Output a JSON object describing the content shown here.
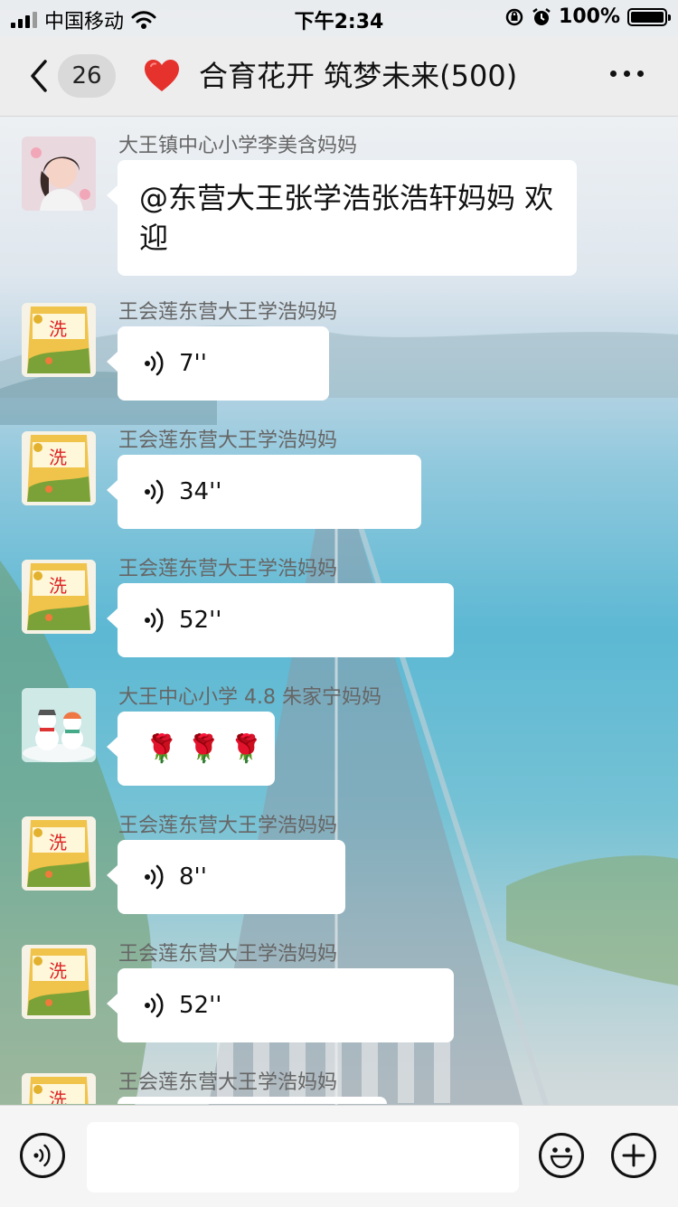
{
  "status_bar": {
    "carrier": "中国移动",
    "time": "下午2:34",
    "battery": "100%"
  },
  "header": {
    "unread_count": "26",
    "title": "合育花开 筑梦未来(500)"
  },
  "messages": [
    {
      "sender": "大王镇中心小学李美含妈妈",
      "type": "text",
      "text": "@东营大王张学浩张浩轩妈妈 欢迎",
      "avatar": "girl-photo"
    },
    {
      "sender": "王会莲东营大王学浩妈妈",
      "type": "voice",
      "duration": "7''",
      "avatar": "product-package"
    },
    {
      "sender": "王会莲东营大王学浩妈妈",
      "type": "voice",
      "duration": "34''",
      "avatar": "product-package"
    },
    {
      "sender": "王会莲东营大王学浩妈妈",
      "type": "voice",
      "duration": "52''",
      "avatar": "product-package"
    },
    {
      "sender": "大王中心小学 4.8 朱家宁妈妈",
      "type": "emoji",
      "emojis": "🌹 🌹 🌹",
      "avatar": "snowman"
    },
    {
      "sender": "王会莲东营大王学浩妈妈",
      "type": "voice",
      "duration": "8''",
      "avatar": "product-package"
    },
    {
      "sender": "王会莲东营大王学浩妈妈",
      "type": "voice",
      "duration": "52''",
      "avatar": "product-package"
    },
    {
      "sender": "王会莲东营大王学浩妈妈",
      "type": "voice",
      "duration": "",
      "avatar": "product-package"
    }
  ],
  "colors": {
    "header_bg": "#ededed",
    "bubble_bg": "#ffffff",
    "heart": "#e5322d"
  }
}
